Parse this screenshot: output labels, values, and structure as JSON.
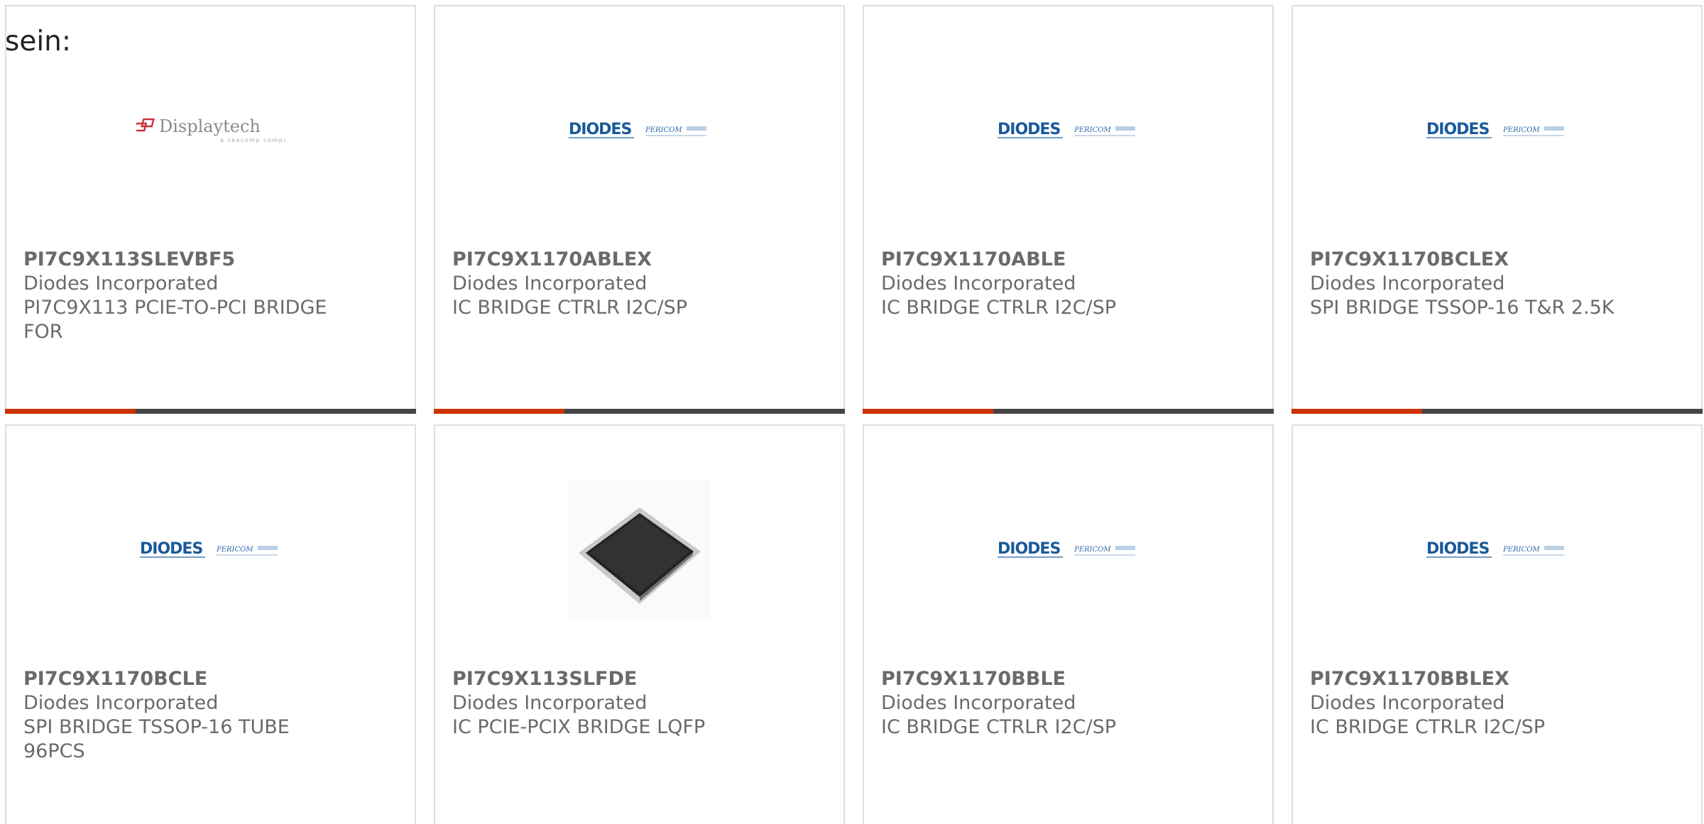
{
  "intro_text": "sein:",
  "colors": {
    "accent": "#cc3300",
    "bar_dark": "#444444",
    "text": "#6a6a6a",
    "diodes_blue": "#1a5a9a",
    "displaytech_red": "#c8323c"
  },
  "products": [
    {
      "mpn": "PI7C9X113SLEVBF5",
      "manufacturer": "Diodes Incorporated",
      "description": "PI7C9X113 PCIE-TO-PCI BRIDGE FOR",
      "image": "displaytech-logo",
      "logo_text": "Displaytech",
      "logo_subtext": "a seacomp company"
    },
    {
      "mpn": "PI7C9X1170ABLEX",
      "manufacturer": "Diodes Incorporated",
      "description": "IC BRIDGE CTRLR I2C/SP",
      "image": "diodes-pericom-logo",
      "logo_text": "DIODES",
      "logo_subtext": "PERICOM"
    },
    {
      "mpn": "PI7C9X1170ABLE",
      "manufacturer": "Diodes Incorporated",
      "description": "IC BRIDGE CTRLR I2C/SP",
      "image": "diodes-pericom-logo",
      "logo_text": "DIODES",
      "logo_subtext": "PERICOM"
    },
    {
      "mpn": "PI7C9X1170BCLEX",
      "manufacturer": "Diodes Incorporated",
      "description": "SPI BRIDGE TSSOP-16 T&R 2.5K",
      "image": "diodes-pericom-logo",
      "logo_text": "DIODES",
      "logo_subtext": "PERICOM"
    },
    {
      "mpn": "PI7C9X1170BCLE",
      "manufacturer": "Diodes Incorporated",
      "description": "SPI BRIDGE TSSOP-16 TUBE 96PCS",
      "image": "diodes-pericom-logo",
      "logo_text": "DIODES",
      "logo_subtext": "PERICOM"
    },
    {
      "mpn": "PI7C9X113SLFDE",
      "manufacturer": "Diodes Incorporated",
      "description": "IC PCIE-PCIX BRIDGE LQFP",
      "image": "lqfp-chip-photo"
    },
    {
      "mpn": "PI7C9X1170BBLE",
      "manufacturer": "Diodes Incorporated",
      "description": "IC BRIDGE CTRLR I2C/SP",
      "image": "diodes-pericom-logo",
      "logo_text": "DIODES",
      "logo_subtext": "PERICOM"
    },
    {
      "mpn": "PI7C9X1170BBLEX",
      "manufacturer": "Diodes Incorporated",
      "description": "IC BRIDGE CTRLR I2C/SP",
      "image": "diodes-pericom-logo",
      "logo_text": "DIODES",
      "logo_subtext": "PERICOM"
    }
  ]
}
